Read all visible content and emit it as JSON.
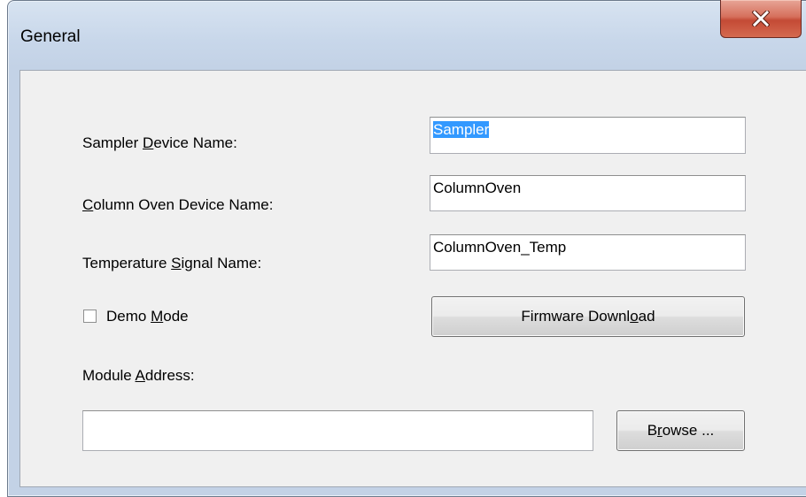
{
  "window": {
    "title": "General",
    "close_glyph": "X"
  },
  "fields": {
    "sampler_device_name": {
      "label_pre": "Sampler ",
      "label_mnemonic": "D",
      "label_post": "evice Name:",
      "value": "Sampler"
    },
    "column_oven_device_name": {
      "label_pre": "",
      "label_mnemonic": "C",
      "label_post": "olumn Oven Device Name:",
      "value": "ColumnOven"
    },
    "temperature_signal_name": {
      "label_pre": "Temperature ",
      "label_mnemonic": "S",
      "label_post": "ignal Name:",
      "value": "ColumnOven_Temp"
    },
    "module_address": {
      "label_pre": "Module ",
      "label_mnemonic": "A",
      "label_post": "ddress:",
      "value": ""
    }
  },
  "demo_mode": {
    "label_pre": "Demo ",
    "label_mnemonic": "M",
    "label_post": "ode",
    "checked": false
  },
  "buttons": {
    "firmware_download": {
      "label_pre": "Firmware Downl",
      "label_mnemonic": "o",
      "label_post": "ad"
    },
    "browse": {
      "label_pre": "B",
      "label_mnemonic": "r",
      "label_post": "owse ..."
    }
  },
  "colors": {
    "selection": "#3399ff",
    "dialog_background": "#f0f0f0",
    "close_button": "#c44a35"
  },
  "icons": {
    "close": "close-icon",
    "checkbox": "checkbox-unchecked-icon"
  }
}
